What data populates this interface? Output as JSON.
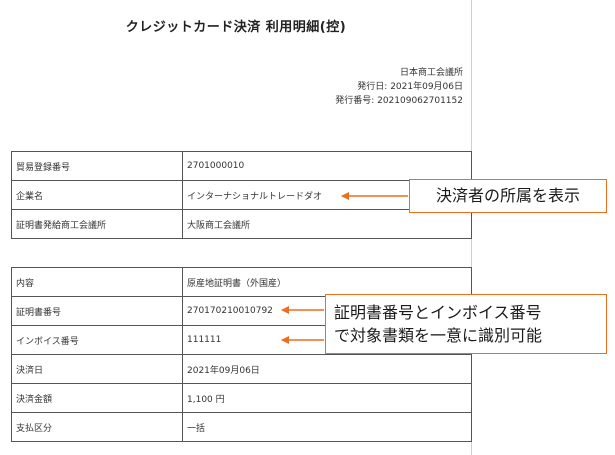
{
  "document": {
    "title": "クレジットカード決済 利用明細(控)",
    "issuer": {
      "name": "日本商工会議所",
      "issue_date": "発行日: 2021年09月06日",
      "issue_number": "発行番号: 202109062701152"
    }
  },
  "table1": {
    "rows": [
      {
        "label": "貿易登録番号",
        "value": "2701000010"
      },
      {
        "label": "企業名",
        "value": "インターナショナルトレードダオ"
      },
      {
        "label": "証明書発給商工会議所",
        "value": "大阪商工会議所"
      }
    ]
  },
  "table2": {
    "rows": [
      {
        "label": "内容",
        "value": "原産地証明書（外国産）"
      },
      {
        "label": "証明書番号",
        "value": "270170210010792"
      },
      {
        "label": "インボイス番号",
        "value": "111111"
      },
      {
        "label": "決済日",
        "value": "2021年09月06日"
      },
      {
        "label": "決済金額",
        "value": "1,100 円"
      },
      {
        "label": "支払区分",
        "value": "一括"
      }
    ]
  },
  "annotations": {
    "callout1": "決済者の所属を表示",
    "callout2_line1": "証明書番号とインボイス番号",
    "callout2_line2": "で対象書類を一意に識別可能",
    "accent_color": "#ec6f1f"
  }
}
